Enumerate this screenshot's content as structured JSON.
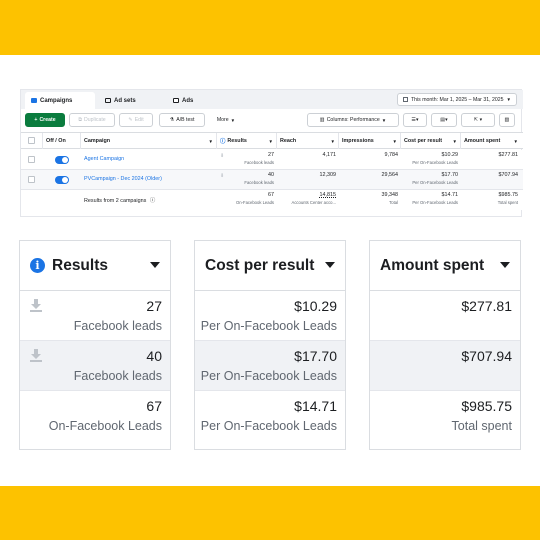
{
  "colors": {
    "brand_band": "#fdc200",
    "accent": "#1b74e4",
    "create_green": "#0a7c3e"
  },
  "ads_manager": {
    "tabs": [
      {
        "label": "Campaigns",
        "icon": "folder-icon"
      },
      {
        "label": "Ad sets",
        "icon": "grid-icon"
      },
      {
        "label": "Ads",
        "icon": "ad-icon"
      }
    ],
    "date_range": "This month: Mar 1, 2025 – Mar 31, 2025",
    "toolbar": {
      "create": "Create",
      "duplicate": "Duplicate",
      "edit": "Edit",
      "ab_test": "A/B test",
      "more": "More",
      "columns": "Columns: Performance"
    },
    "columns": [
      "Off / On",
      "Campaign",
      "Results",
      "Reach",
      "Impressions",
      "Cost per result",
      "Amount spent"
    ],
    "rows": [
      {
        "campaign": "Agent Campaign",
        "results": "27",
        "results_sub": "Facebook leads",
        "reach": "4,171",
        "impressions": "9,784",
        "cost": "$10.29",
        "cost_sub": "Per On-Facebook Leads",
        "spent": "$277.81"
      },
      {
        "campaign": "PVCampaign - Dec 2024 (Older)",
        "results": "40",
        "results_sub": "Facebook leads",
        "reach": "12,309",
        "impressions": "29,564",
        "cost": "$17.70",
        "cost_sub": "Per On-Facebook Leads",
        "spent": "$707.94"
      }
    ],
    "summary": {
      "label": "Results from 2 campaigns",
      "results": "67",
      "results_sub": "On-Facebook Leads",
      "reach": "14,815",
      "reach_sub": "Accounts Center acco...",
      "impressions": "39,348",
      "impressions_sub": "Total",
      "cost": "$14.71",
      "cost_sub": "Per On-Facebook Leads",
      "spent": "$985.75",
      "spent_sub": "Total spent"
    }
  },
  "cards": {
    "results": {
      "title": "Results",
      "rows": [
        {
          "value": "27",
          "label": "Facebook leads"
        },
        {
          "value": "40",
          "label": "Facebook leads"
        },
        {
          "value": "67",
          "label": "On-Facebook Leads"
        }
      ]
    },
    "cost": {
      "title": "Cost per result",
      "rows": [
        {
          "value": "$10.29",
          "label": "Per On-Facebook Leads"
        },
        {
          "value": "$17.70",
          "label": "Per On-Facebook Leads"
        },
        {
          "value": "$14.71",
          "label": "Per On-Facebook Leads"
        }
      ]
    },
    "spent": {
      "title": "Amount spent",
      "rows": [
        {
          "value": "$277.81"
        },
        {
          "value": "$707.94"
        },
        {
          "value": "$985.75",
          "label": "Total spent"
        }
      ]
    }
  }
}
